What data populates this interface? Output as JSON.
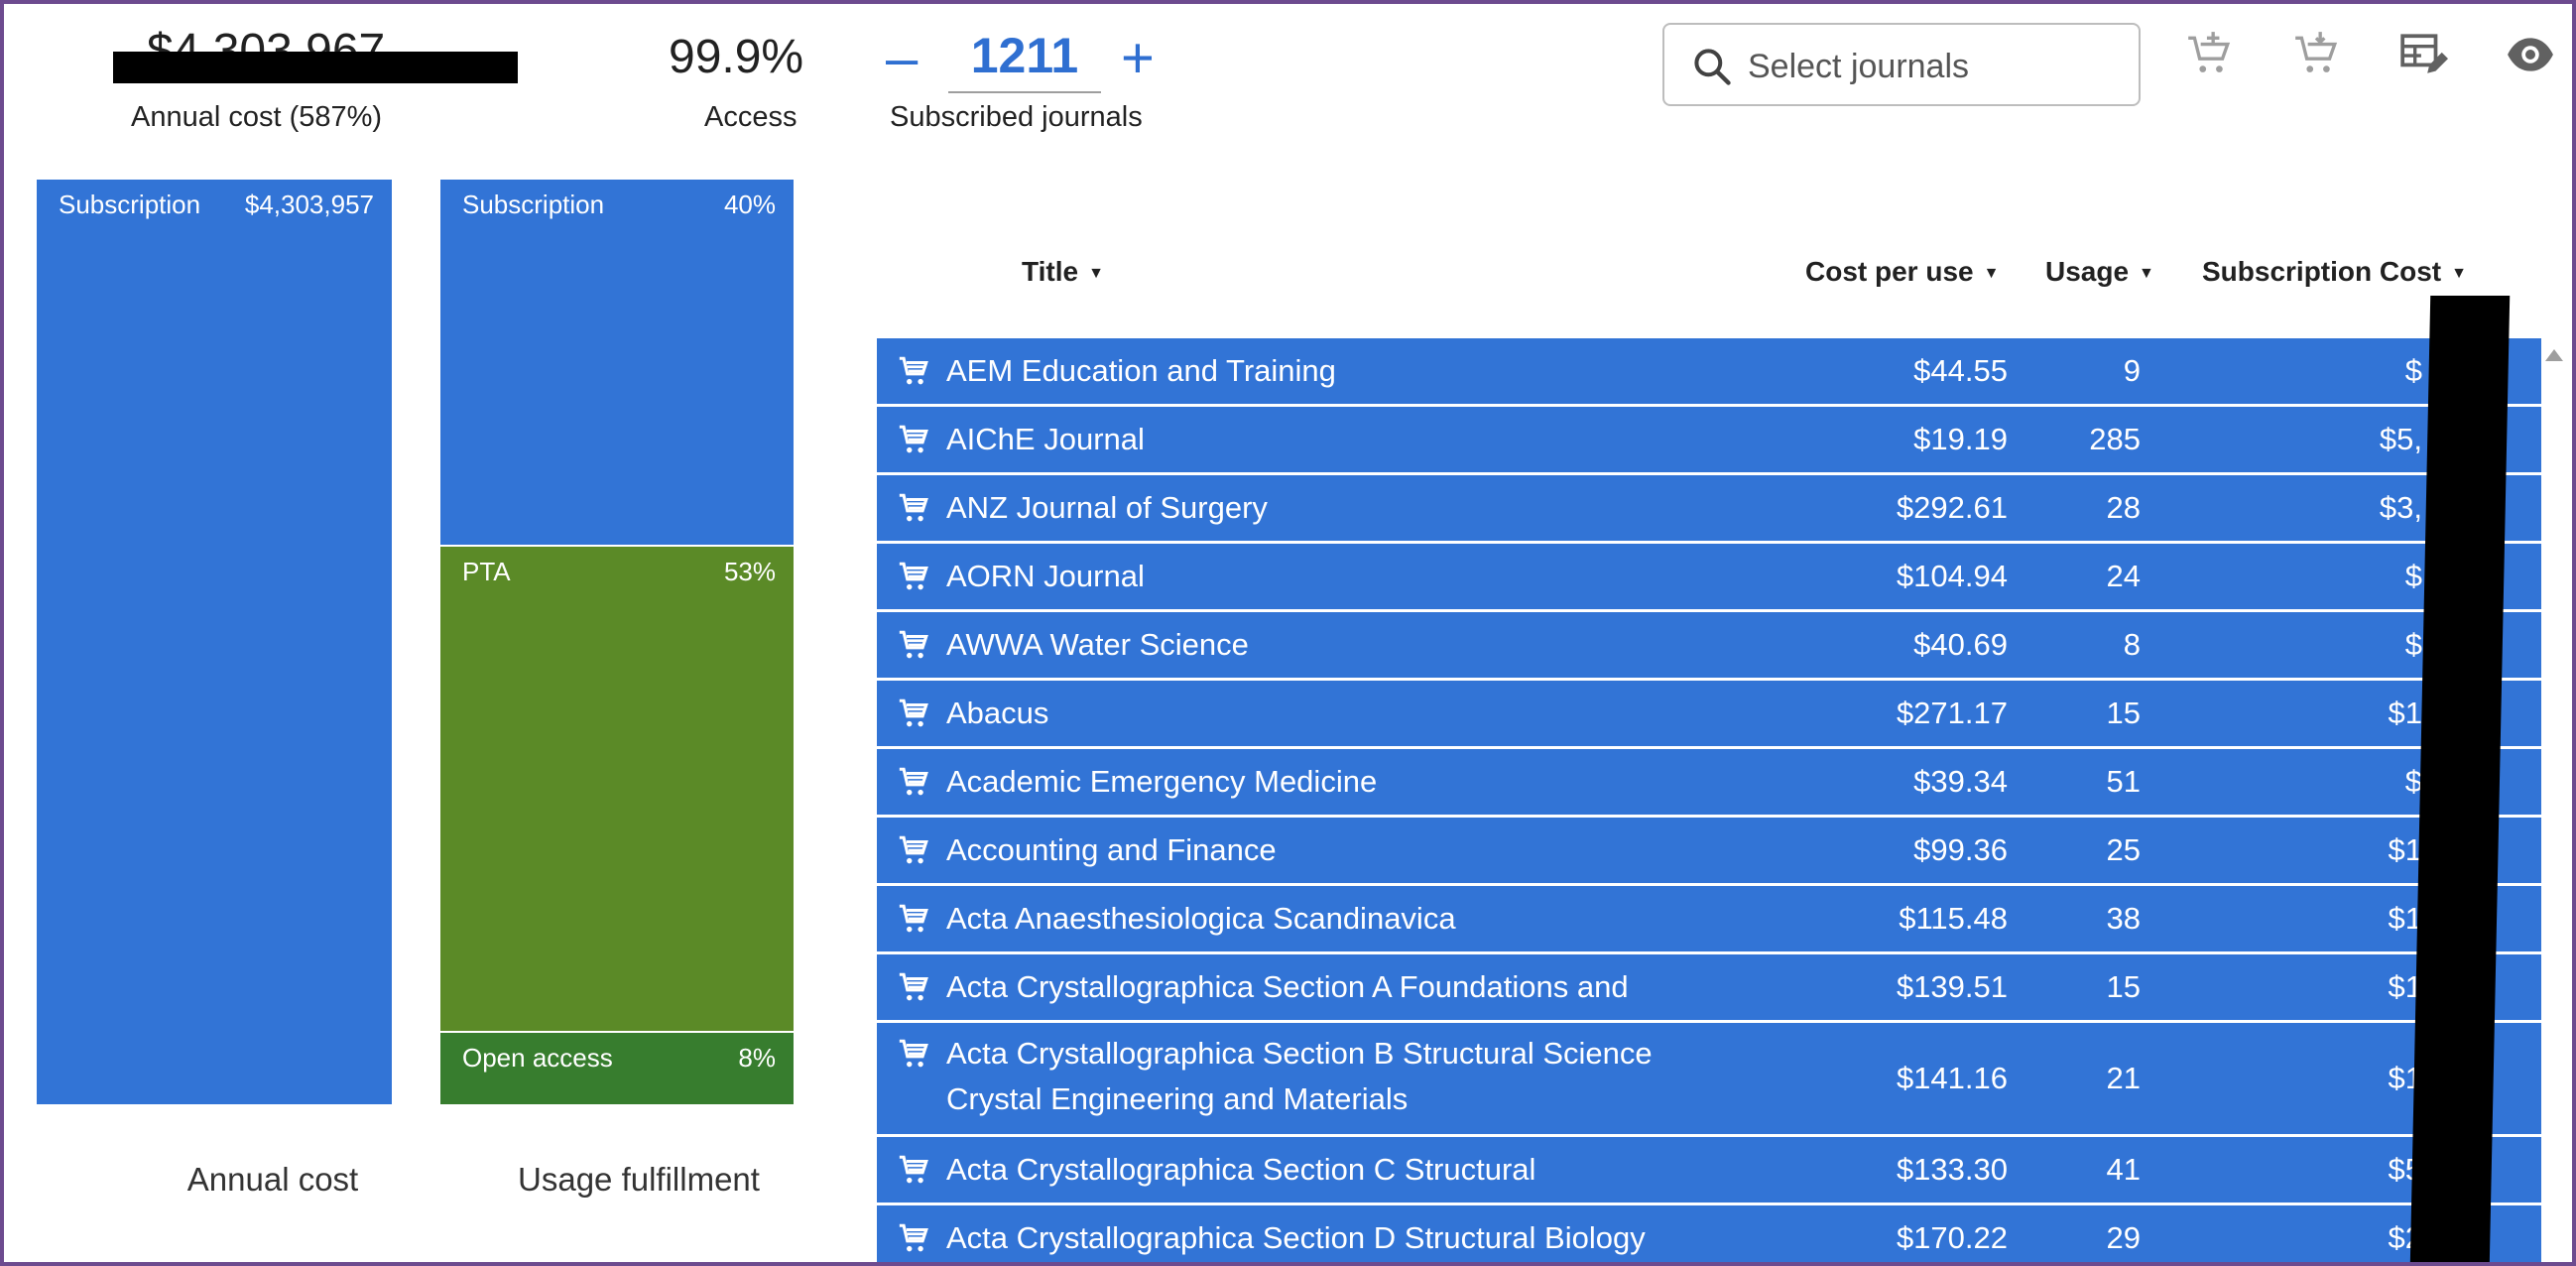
{
  "stats": {
    "annual_cost_value": "$4,303,967",
    "annual_cost_label": "Annual cost (587%)",
    "access_value": "99.9%",
    "access_label": "Access",
    "subscribed_count": "1211",
    "subscribed_label": "Subscribed journals",
    "minus": "–",
    "plus": "+"
  },
  "search": {
    "placeholder": "Select journals"
  },
  "toolbar_icons": [
    "cart-add-icon",
    "cart-remove-icon",
    "table-edit-icon",
    "eye-icon"
  ],
  "colors": {
    "subscription": "#3274d6",
    "pta": "#5b8a27",
    "open_access": "#377d2e",
    "accent": "#2f6fd1"
  },
  "annual_cost_chart": {
    "caption": "Annual cost",
    "segments": [
      {
        "label": "Subscription",
        "value": "$4,303,957"
      }
    ]
  },
  "usage_chart": {
    "caption": "Usage fulfillment",
    "segments": [
      {
        "label": "Subscription",
        "pct": "40%"
      },
      {
        "label": "PTA",
        "pct": "53%"
      },
      {
        "label": "Open access",
        "pct": "8%"
      }
    ]
  },
  "table": {
    "headers": {
      "title": "Title",
      "cost_per_use": "Cost per use",
      "usage": "Usage",
      "subscription_cost": "Subscription Cost"
    },
    "sort_glyph": "▼",
    "rows": [
      {
        "title": "AEM Education and Training",
        "cpu": "$44.55",
        "usage": "9",
        "sub": "$"
      },
      {
        "title": "AIChE Journal",
        "cpu": "$19.19",
        "usage": "285",
        "sub": "$5,"
      },
      {
        "title": "ANZ Journal of Surgery",
        "cpu": "$292.61",
        "usage": "28",
        "sub": "$3,"
      },
      {
        "title": "AORN Journal",
        "cpu": "$104.94",
        "usage": "24",
        "sub": "$"
      },
      {
        "title": "AWWA Water Science",
        "cpu": "$40.69",
        "usage": "8",
        "sub": "$"
      },
      {
        "title": "Abacus",
        "cpu": "$271.17",
        "usage": "15",
        "sub": "$1"
      },
      {
        "title": "Academic Emergency Medicine",
        "cpu": "$39.34",
        "usage": "51",
        "sub": "$"
      },
      {
        "title": "Accounting and Finance",
        "cpu": "$99.36",
        "usage": "25",
        "sub": "$1"
      },
      {
        "title": "Acta Anaesthesiologica Scandinavica",
        "cpu": "$115.48",
        "usage": "38",
        "sub": "$1"
      },
      {
        "title": "Acta Crystallographica Section A Foundations and Advances",
        "cpu": "$139.51",
        "usage": "15",
        "sub": "$1"
      },
      {
        "title": "Acta Crystallographica Section B Structural Science Crystal Engineering and Materials",
        "cpu": "$141.16",
        "usage": "21",
        "sub": "$1"
      },
      {
        "title": "Acta Crystallographica Section C Structural Chemistry",
        "cpu": "$133.30",
        "usage": "41",
        "sub": "$5"
      },
      {
        "title": "Acta Crystallographica Section D Structural Biology",
        "cpu": "$170.22",
        "usage": "29",
        "sub": "$2"
      }
    ]
  }
}
